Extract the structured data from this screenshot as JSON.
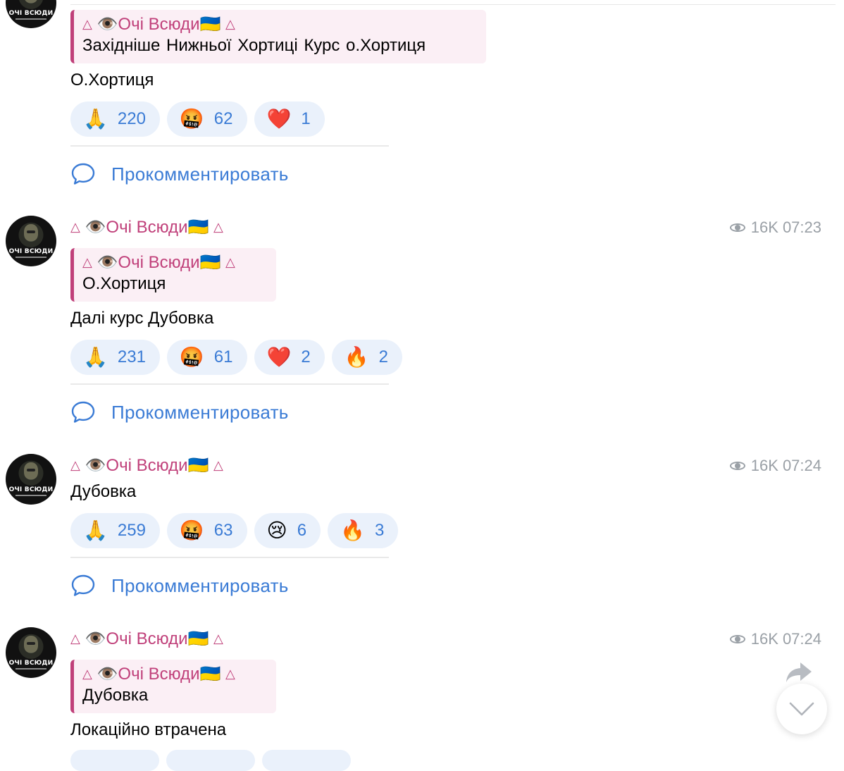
{
  "channel": {
    "name": "Очі Всюди",
    "flag": "🇺🇦",
    "eye_emoji": "👁️",
    "triangle": "△",
    "avatar_text": "ОЧІ ВСЮДИ"
  },
  "comment_label": "Прокомментировать",
  "posts": [
    {
      "quote": {
        "author": "Очі Всюди",
        "text": "Західніше Нижньої Хортиці   Курс о.Хортиця"
      },
      "text": "О.Хортиця",
      "reactions": [
        {
          "emoji": "🙏",
          "count": "220"
        },
        {
          "emoji": "🤬",
          "count": "62"
        },
        {
          "emoji": "❤️",
          "count": "1"
        }
      ]
    },
    {
      "author": "Очі Всюди",
      "views": "16K",
      "time": "07:23",
      "quote": {
        "author": "Очі Всюди",
        "text": "О.Хортиця"
      },
      "text": "Далі курс Дубовка",
      "reactions": [
        {
          "emoji": "🙏",
          "count": "231"
        },
        {
          "emoji": "🤬",
          "count": "61"
        },
        {
          "emoji": "❤️",
          "count": "2"
        },
        {
          "emoji": "🔥",
          "count": "2"
        }
      ]
    },
    {
      "author": "Очі Всюди",
      "views": "16K",
      "time": "07:24",
      "text": "Дубовка",
      "reactions": [
        {
          "emoji": "🙏",
          "count": "259"
        },
        {
          "emoji": "🤬",
          "count": "63"
        },
        {
          "emoji": "😢",
          "count": "6"
        },
        {
          "emoji": "🔥",
          "count": "3"
        }
      ]
    },
    {
      "author": "Очі Всюди",
      "views": "16K",
      "time": "07:24",
      "quote": {
        "author": "Очі Всюди",
        "text": "Дубовка"
      },
      "text": "Локаційно втрачена"
    }
  ],
  "colors": {
    "author": "#c0407a",
    "accent": "#3a7bd5",
    "reaction_bg": "#eaf1fb",
    "quote_bg": "#fbeff5",
    "meta": "#9aa0a6"
  }
}
